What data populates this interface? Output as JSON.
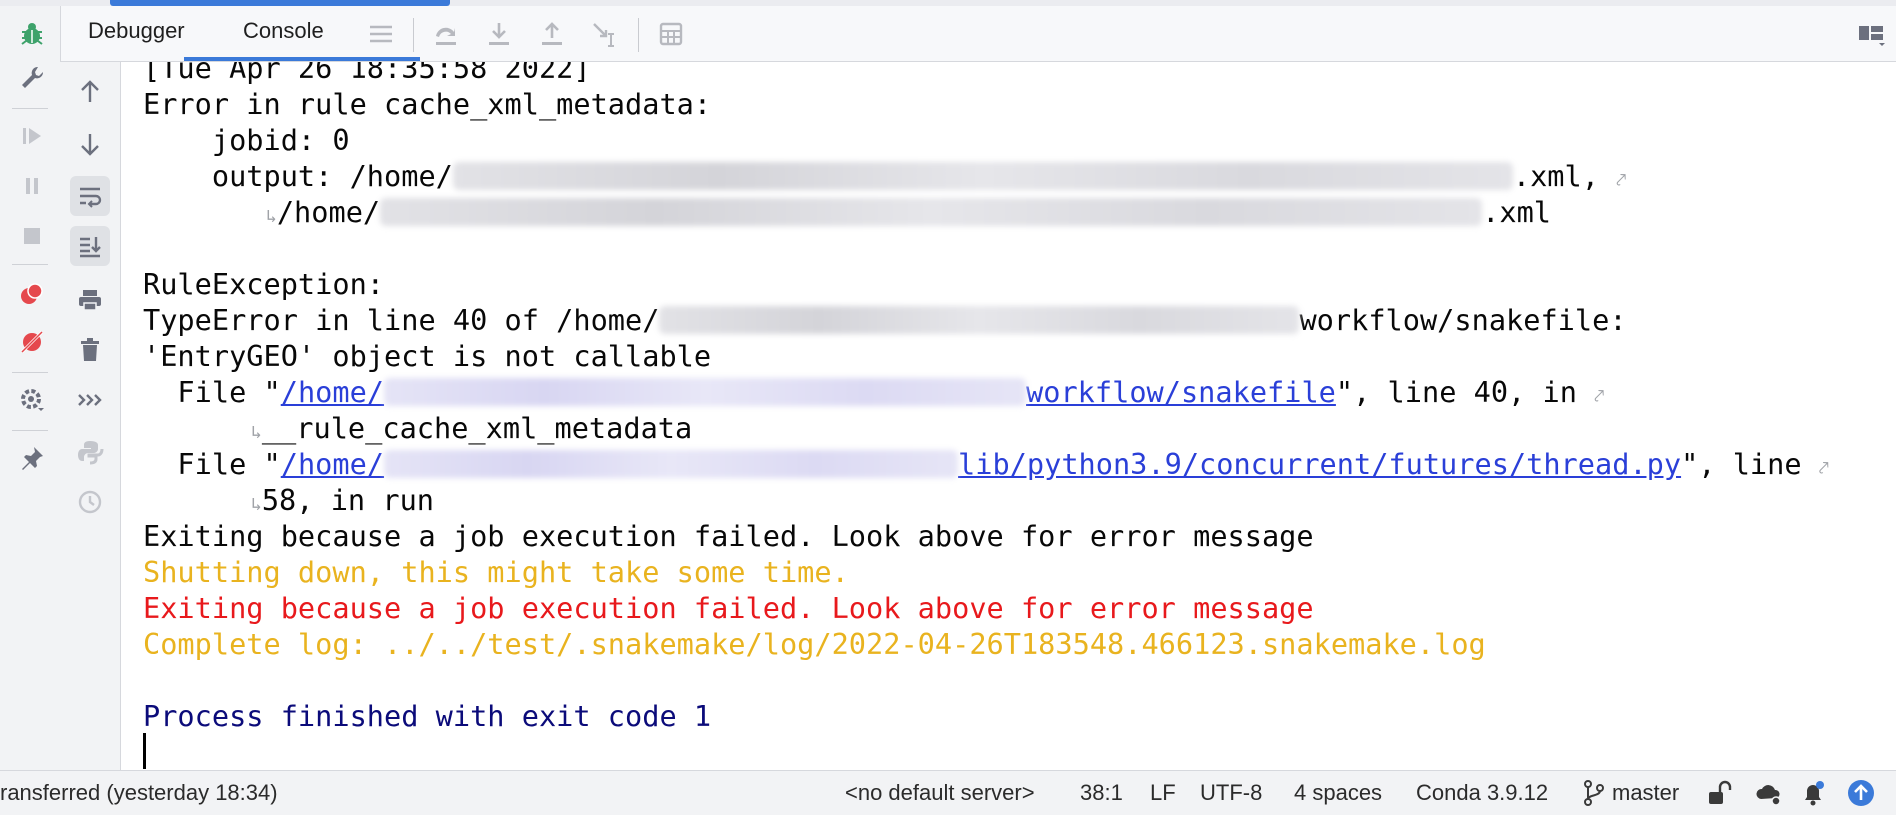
{
  "tabs": {
    "debugger": "Debugger",
    "console": "Console"
  },
  "console": {
    "timestamp_line": "[Tue Apr 26 18:35:58 2022]",
    "error_rule": "Error in rule cache_xml_metadata:",
    "jobid": "    jobid: 0",
    "output_prefix": "    output: /home/",
    "output_suffix": ".xml,",
    "output2_prefix": "/home/",
    "output2_suffix": ".xml",
    "rule_exception": "RuleException:",
    "type_error_prefix": "TypeError in line 40 of /home/",
    "type_error_suffix": "workflow/snakefile:",
    "not_callable": "'EntryGEO' object is not callable",
    "file1_prefix": "  File \"",
    "file1_link_a": "/home/",
    "file1_link_b": "workflow/snakefile",
    "file1_suffix": "\", line 40, in",
    "file1_cont": "__rule_cache_xml_metadata",
    "file2_prefix": "  File \"",
    "file2_link_a": "/home/",
    "file2_link_b": "lib/python3.9/concurrent/futures/thread.py",
    "file2_suffix": "\", line",
    "file2_cont": "58, in run",
    "exiting_black": "Exiting because a job execution failed. Look above for error message",
    "shutting_down": "Shutting down, this might take some time.",
    "exiting_red": "Exiting because a job execution failed. Look above for error message",
    "complete_log": "Complete log: ../../test/.snakemake/log/2022-04-26T183548.466123.snakemake.log",
    "process_finished": "Process finished with exit code 1"
  },
  "statusbar": {
    "transfer": "ransferred (yesterday 18:34)",
    "server": "<no default server>",
    "position": "38:1",
    "line_sep": "LF",
    "encoding": "UTF-8",
    "indent": "4 spaces",
    "interpreter": "Conda 3.9.12",
    "branch": "master"
  },
  "colors": {
    "accent": "#3b7ad9",
    "warning": "#e9b31f",
    "error": "#e8191c",
    "link": "#2a3fd8",
    "exit": "#0b0b7a"
  }
}
